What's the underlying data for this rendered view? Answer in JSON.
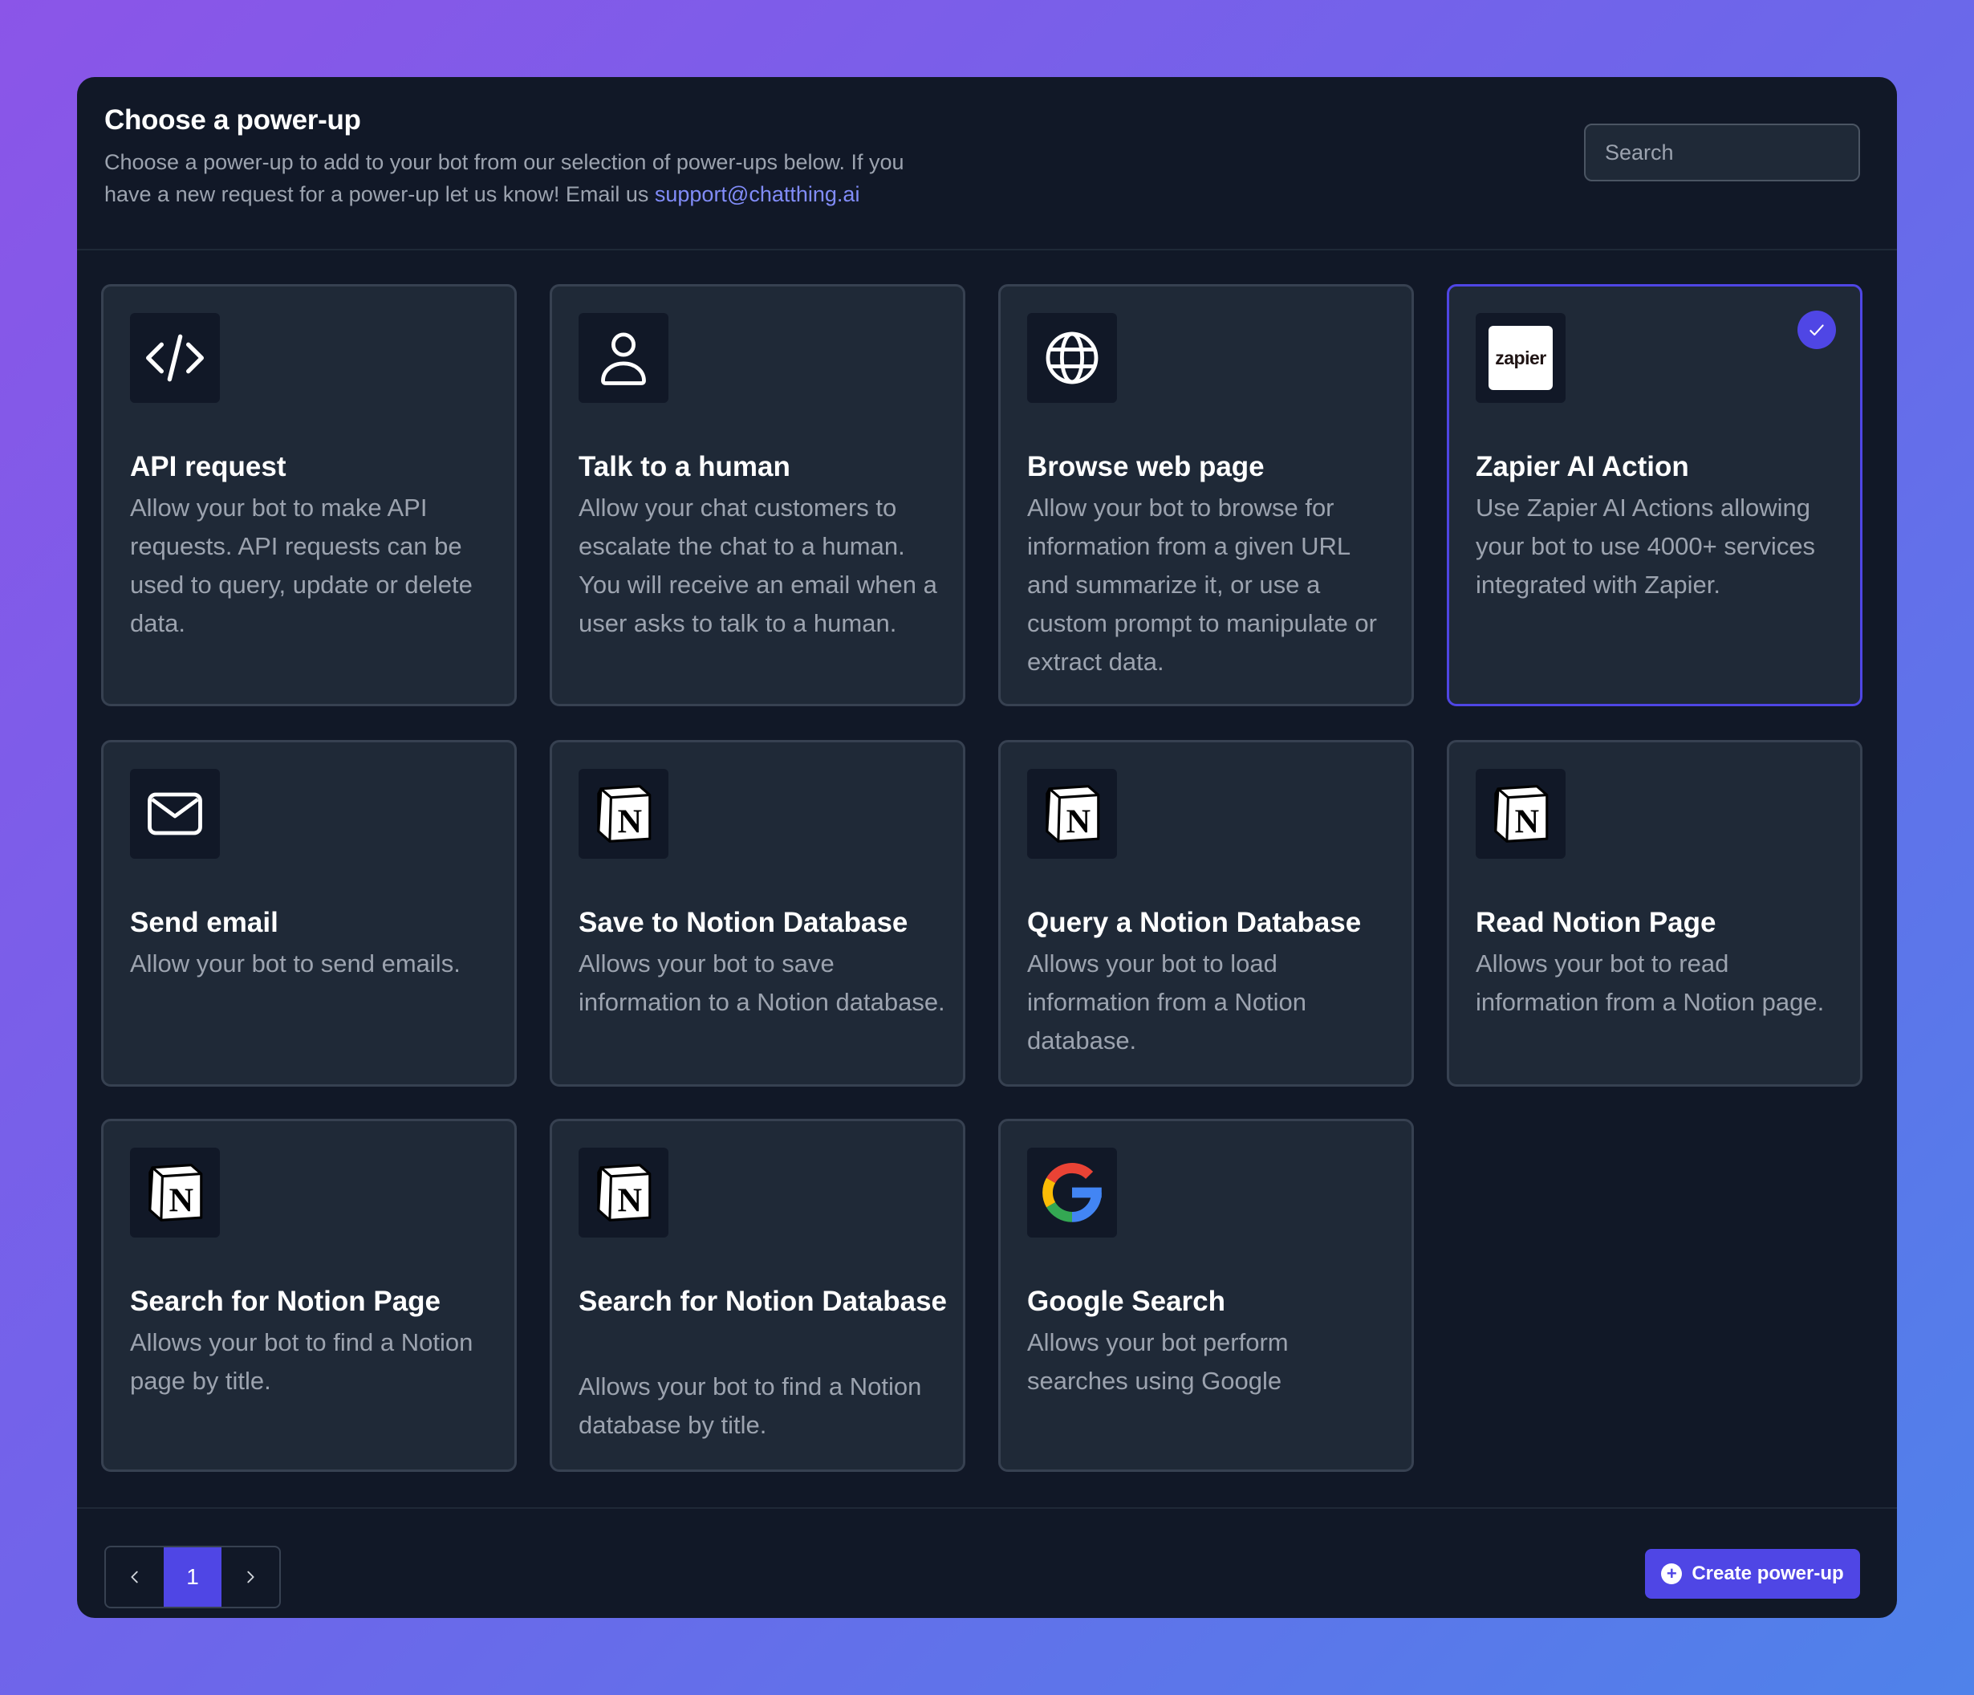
{
  "header": {
    "title": "Choose a power-up",
    "subtitle": "Choose a power-up to add to your bot from our selection of power-ups below. If you have a new request for a power-up let us know! Email us",
    "email": "support@chatthing.ai",
    "search_placeholder": "Search"
  },
  "cards": [
    {
      "title": "API request",
      "desc": "Allow your bot to make API requests. API requests can be used to query, update or delete data.",
      "icon": "code-icon"
    },
    {
      "title": "Talk to a human",
      "desc": "Allow your chat customers to escalate the chat to a human. You will receive an email when a user asks to talk to a human.",
      "icon": "person-icon"
    },
    {
      "title": "Browse web page",
      "desc": "Allow your bot to browse for information from a given URL and summarize it, or use a custom prompt to manipulate or extract data.",
      "icon": "globe-icon"
    },
    {
      "title": "Zapier AI Action",
      "desc": "Use Zapier AI Actions allowing your bot to use 4000+ services integrated with Zapier.",
      "icon": "zapier-logo",
      "logo_text": "zapier",
      "selected": true
    },
    {
      "title": "Send email",
      "desc": "Allow your bot to send emails.",
      "icon": "envelope-icon"
    },
    {
      "title": "Save to Notion Database",
      "desc": "Allows your bot to save information to a Notion database.",
      "icon": "notion-logo"
    },
    {
      "title": "Query a Notion Database",
      "desc": "Allows your bot to load information from a Notion database.",
      "icon": "notion-logo"
    },
    {
      "title": "Read Notion Page",
      "desc": "Allows your bot to read information from a Notion page.",
      "icon": "notion-logo"
    },
    {
      "title": "Search for Notion Page",
      "desc": "Allows your bot to find a Notion page by title.",
      "icon": "notion-logo"
    },
    {
      "title": "Search for Notion Database",
      "desc": "Allows your bot to find a Notion database by title.",
      "icon": "notion-logo"
    },
    {
      "title": "Google Search",
      "desc": "Allows your bot perform searches using Google",
      "icon": "google-logo"
    }
  ],
  "pagination": {
    "current_page": "1",
    "prev_icon": "chevron-left-icon",
    "next_icon": "chevron-right-icon"
  },
  "footer": {
    "create_label": "Create power-up",
    "create_icon": "plus-circle-icon"
  },
  "colors": {
    "accent": "#4f46e5",
    "link": "#818cf8",
    "card_bg": "#1f2937",
    "modal_bg": "#111827"
  }
}
